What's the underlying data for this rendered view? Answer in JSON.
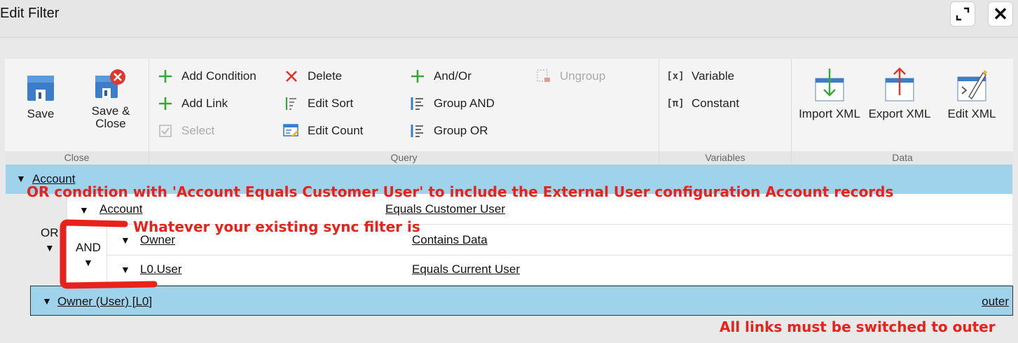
{
  "window": {
    "title": "Edit Filter",
    "expand_icon": "expand-icon",
    "close_icon": "close-icon",
    "close_glyph": "✕"
  },
  "ribbon": {
    "close_group": {
      "label": "Close",
      "save": "Save",
      "save_close_line1": "Save &",
      "save_close_line2": "Close"
    },
    "query_group": {
      "label": "Query",
      "add_condition": "Add Condition",
      "add_link": "Add Link",
      "select": "Select",
      "delete": "Delete",
      "edit_sort": "Edit Sort",
      "edit_count": "Edit Count",
      "and_or": "And/Or",
      "group_and": "Group AND",
      "group_or": "Group OR",
      "ungroup": "Ungroup"
    },
    "variables_group": {
      "label": "Variables",
      "variable": "Variable",
      "variable_glyph": "[x]",
      "constant": "Constant",
      "constant_glyph": "[π]"
    },
    "data_group": {
      "label": "Data",
      "import_xml": "Import XML",
      "export_xml": "Export XML",
      "edit_xml": "Edit XML"
    }
  },
  "tree": {
    "root_entity": "Account",
    "or_label": "OR",
    "and_label": "AND",
    "toggle_glyph": "▼",
    "conditions": [
      {
        "field": "Account",
        "operator": "Equals Customer User"
      },
      {
        "field": "Owner",
        "operator": "Contains Data"
      },
      {
        "field": "L0.User",
        "operator": "Equals Current User"
      }
    ],
    "link": {
      "entity": "Owner (User) [L0]",
      "join_type": "outer"
    }
  },
  "annotations": {
    "or_note": "OR condition with 'Account Equals Customer User' to include the External User configuration Account records",
    "sync_note": "Whatever your existing sync filter is",
    "links_note": "All links must be switched to outer"
  },
  "colors": {
    "accent_row": "#9fd2eb",
    "annotation": "#e8221a",
    "icon_green": "#3aa53a",
    "icon_red": "#e0362c",
    "icon_blue": "#3b7dc8"
  }
}
